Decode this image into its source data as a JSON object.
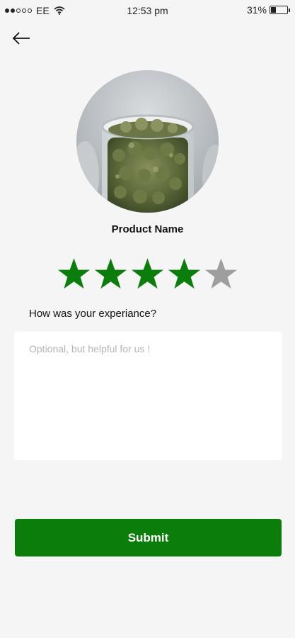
{
  "status_bar": {
    "carrier": "EE",
    "time": "12:53 pm",
    "battery": "31%",
    "battery_level": 0.31,
    "signal_bars_filled": 2,
    "signal_bars_total": 5
  },
  "nav": {
    "back_icon": "arrow-left-icon"
  },
  "product": {
    "name": "Product Name",
    "image": "product-jar-photo"
  },
  "rating": {
    "value": 4,
    "max": 5,
    "filled_color": "#0a7d0a",
    "empty_color": "#9e9e9e"
  },
  "review": {
    "question": "How was your experiance?",
    "placeholder": "Optional, but helpful for us !",
    "value": ""
  },
  "submit": {
    "label": "Submit",
    "color": "#0a7d0a"
  }
}
